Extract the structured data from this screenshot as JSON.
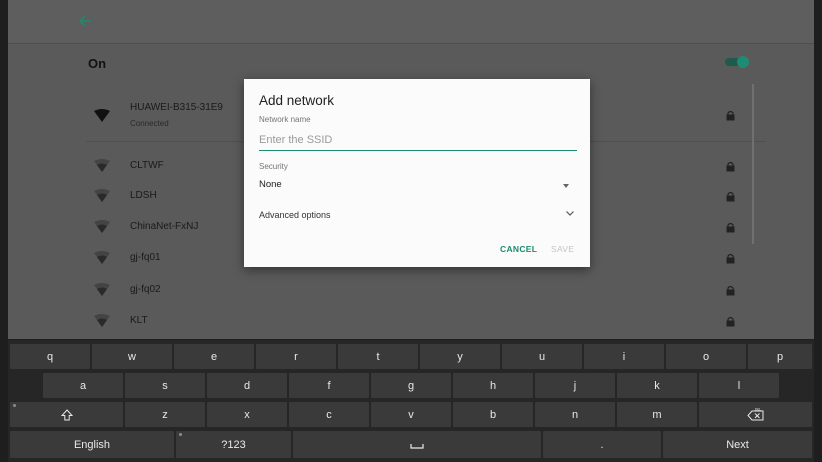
{
  "wifi": {
    "toggle_label": "On",
    "networks": [
      {
        "name": "HUAWEI-B315-31E9",
        "status": "Connected"
      },
      {
        "name": "CLTWF"
      },
      {
        "name": "LDSH"
      },
      {
        "name": "ChinaNet-FxNJ"
      },
      {
        "name": "gj-fq01"
      },
      {
        "name": "gj-fq02"
      },
      {
        "name": "KLT"
      }
    ]
  },
  "dialog": {
    "title": "Add network",
    "network_name_label": "Network name",
    "ssid_placeholder": "Enter the SSID",
    "ssid_value": "",
    "security_label": "Security",
    "security_value": "None",
    "advanced_label": "Advanced options",
    "cancel_label": "CANCEL",
    "save_label": "SAVE"
  },
  "keyboard": {
    "row1": [
      "q",
      "w",
      "e",
      "r",
      "t",
      "y",
      "u",
      "i",
      "o",
      "p"
    ],
    "row2": [
      "a",
      "s",
      "d",
      "f",
      "g",
      "h",
      "j",
      "k",
      "l"
    ],
    "row3": [
      "z",
      "x",
      "c",
      "v",
      "b",
      "n",
      "m"
    ],
    "shift_icon": "shift-icon",
    "delete_icon": "delete-icon",
    "space_icon": "space-icon",
    "language_label": "English",
    "symbols_label": "?123",
    "period_label": ".",
    "next_label": "Next"
  },
  "colors": {
    "accent": "#1e8a6e",
    "keyboard_bg": "#262626",
    "key_bg": "#3a3a3a",
    "scrim": "#5a5a5a"
  }
}
